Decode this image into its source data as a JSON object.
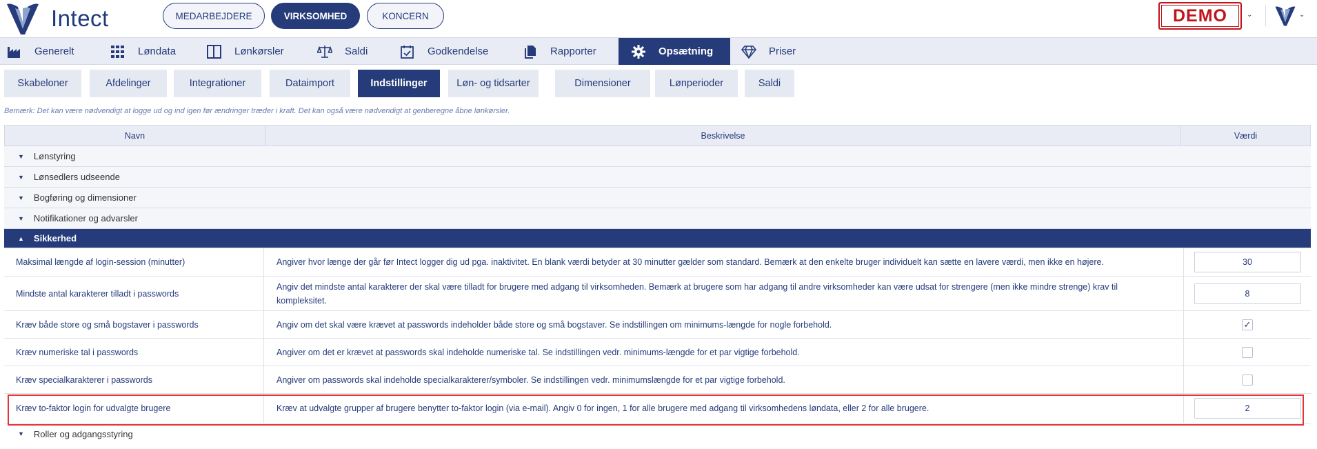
{
  "top": {
    "logo_text": "Intect",
    "tabs": [
      "MEDARBEJDERE",
      "VIRKSOMHED",
      "KONCERN"
    ],
    "active_tab": "VIRKSOMHED",
    "demo_label": "DEMO"
  },
  "mainnav": {
    "items": [
      {
        "label": "Generelt",
        "icon": "factory-icon"
      },
      {
        "label": "Løndata",
        "icon": "grid-table-icon"
      },
      {
        "label": "Lønkørsler",
        "icon": "columns-icon"
      },
      {
        "label": "Saldi",
        "icon": "scale-icon"
      },
      {
        "label": "Godkendelse",
        "icon": "calendar-check-icon"
      },
      {
        "label": "Rapporter",
        "icon": "documents-icon"
      },
      {
        "label": "Opsætning",
        "icon": "gear-icon"
      },
      {
        "label": "Priser",
        "icon": "diamond-icon"
      }
    ],
    "active": "Opsætning"
  },
  "subtabs": [
    "Skabeloner",
    "Afdelinger",
    "Integrationer",
    "Dataimport",
    "Indstillinger",
    "Løn- og tidsarter",
    "Dimensioner",
    "Lønperioder",
    "Saldi"
  ],
  "active_subtab": "Indstillinger",
  "note": "Bemærk: Det kan være nødvendigt at logge ud og ind igen før ændringer træder i kraft. Det kan også være nødvendigt at genberegne åbne lønkørsler.",
  "table": {
    "headers": [
      "Navn",
      "Beskrivelse",
      "Værdi"
    ],
    "groups": [
      {
        "label": "Lønstyring",
        "expanded": false
      },
      {
        "label": "Lønsedlers udseende",
        "expanded": false
      },
      {
        "label": "Bogføring og dimensioner",
        "expanded": false
      },
      {
        "label": "Notifikationer og advarsler",
        "expanded": false
      },
      {
        "label": "Sikkerhed",
        "expanded": true
      },
      {
        "label": "Roller og adgangsstyring",
        "expanded": false
      }
    ],
    "rows": [
      {
        "name": "Maksimal længde af login-session (minutter)",
        "desc": "Angiver hvor længe der går før Intect logger dig ud pga. inaktivitet. En blank værdi betyder at 30 minutter gælder som standard. Bemærk at den enkelte bruger individuelt kan sætte en lavere værdi, men ikke en højere.",
        "type": "text",
        "value": "30"
      },
      {
        "name": "Mindste antal karakterer tilladt i passwords",
        "desc": "Angiv det mindste antal karakterer der skal være tilladt for brugere med adgang til virksomheden. Bemærk at brugere som har adgang til andre virksomheder kan være udsat for strengere (men ikke mindre strenge) krav til kompleksitet.",
        "type": "text",
        "value": "8"
      },
      {
        "name": "Kræv både store og små bogstaver i passwords",
        "desc": "Angiv om det skal være krævet at passwords indeholder både store og små bogstaver. Se indstillingen om minimums-længde for nogle forbehold.",
        "type": "checkbox",
        "value": "✓"
      },
      {
        "name": "Kræv numeriske tal i passwords",
        "desc": "Angiver om det er krævet at passwords skal indeholde numeriske tal. Se indstillingen vedr. minimums-længde for et par vigtige forbehold.",
        "type": "checkbox",
        "value": ""
      },
      {
        "name": "Kræv specialkarakterer i passwords",
        "desc": "Angiver om passwords skal indeholde specialkarakterer/symboler. Se indstillingen vedr. minimumslængde for et par vigtige forbehold.",
        "type": "checkbox",
        "value": ""
      },
      {
        "name": "Kræv to-faktor login for udvalgte brugere",
        "desc": "Kræv at udvalgte grupper af brugere benytter to-faktor login (via e-mail). Angiv 0 for ingen, 1 for alle brugere med adgang til virksomhedens løndata, eller 2 for alle brugere.",
        "type": "text",
        "value": "2"
      }
    ]
  },
  "colors": {
    "primary": "#253b7a",
    "demo_red": "#c0141b",
    "highlight": "#e2363b"
  }
}
